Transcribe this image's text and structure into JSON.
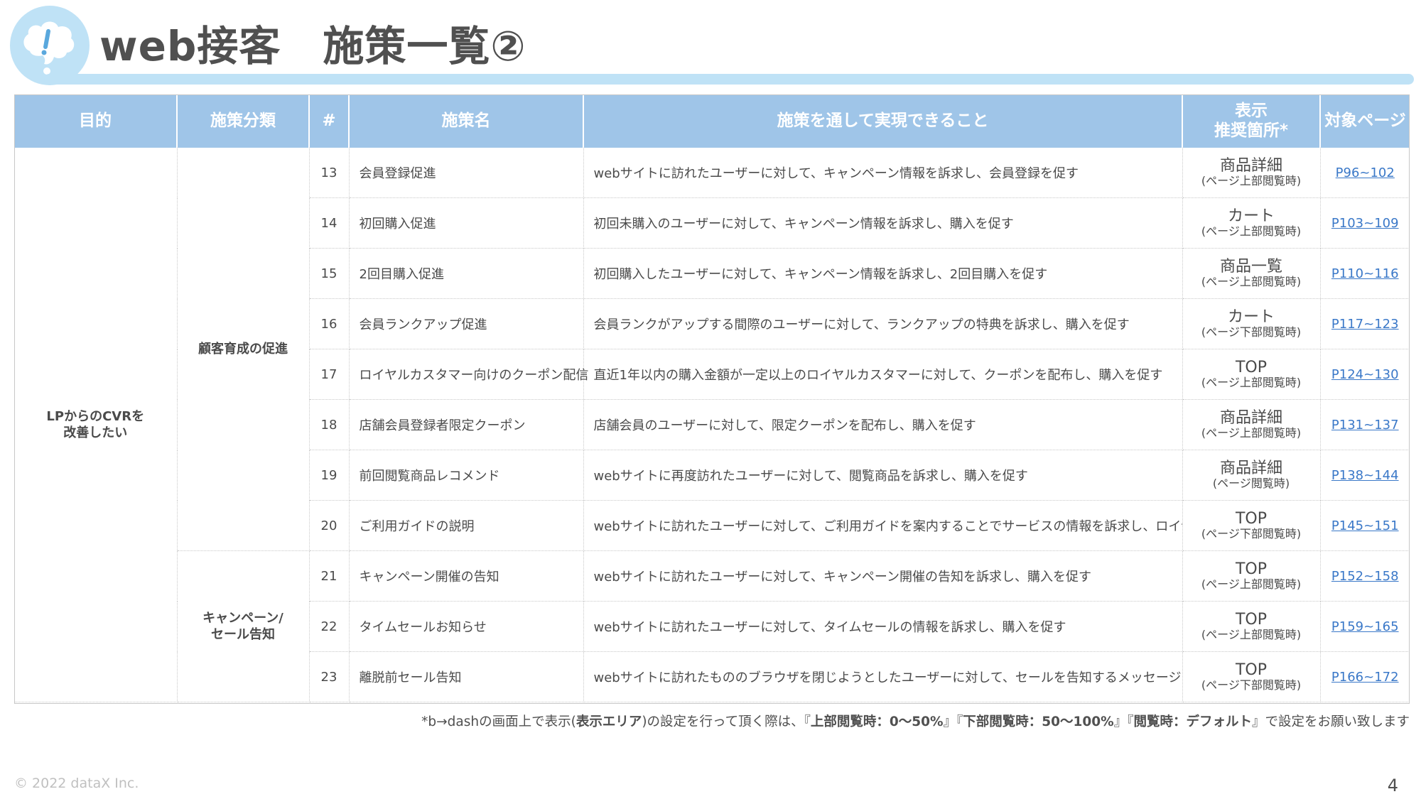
{
  "header": {
    "title": "web接客　施策一覧②",
    "logo_icon": "speech-bubble-exclamation-icon",
    "accent_color": "#bfe2f6"
  },
  "table": {
    "columns": [
      "目的",
      "施策分類",
      "#",
      "施策名",
      "施策を通して実現できること",
      "表示\n推奨箇所*",
      "対象ページ"
    ],
    "header_color": "#9fc5e8",
    "purpose": "LPからのCVRを\n改善したい",
    "categories": [
      {
        "label": "顧客育成の促進",
        "rows": 8
      },
      {
        "label": "キャンペーン/\nセール告知",
        "rows": 3
      }
    ],
    "rows": [
      {
        "num": "13",
        "name": "会員登録促進",
        "desc": "webサイトに訪れたユーザーに対して、キャンペーン情報を訴求し、会員登録を促す",
        "loc": "商品詳細",
        "loc_sub": "(ページ上部閲覧時)",
        "pages": "P96~102"
      },
      {
        "num": "14",
        "name": "初回購入促進",
        "desc": "初回未購入のユーザーに対して、キャンペーン情報を訴求し、購入を促す",
        "loc": "カート",
        "loc_sub": "(ページ上部閲覧時)",
        "pages": "P103~109"
      },
      {
        "num": "15",
        "name": "2回目購入促進",
        "desc": "初回購入したユーザーに対して、キャンペーン情報を訴求し、2回目購入を促す",
        "loc": "商品一覧",
        "loc_sub": "(ページ上部閲覧時)",
        "pages": "P110~116"
      },
      {
        "num": "16",
        "name": "会員ランクアップ促進",
        "desc": "会員ランクがアップする間際のユーザーに対して、ランクアップの特典を訴求し、購入を促す",
        "loc": "カート",
        "loc_sub": "(ページ下部閲覧時)",
        "pages": "P117~123"
      },
      {
        "num": "17",
        "name": "ロイヤルカスタマー向けのクーポン配信",
        "desc": "直近1年以内の購入金額が一定以上のロイヤルカスタマーに対して、クーポンを配布し、購入を促す",
        "loc": "TOP",
        "loc_sub": "(ページ上部閲覧時)",
        "pages": "P124~130"
      },
      {
        "num": "18",
        "name": "店舗会員登録者限定クーポン",
        "desc": "店舗会員のユーザーに対して、限定クーポンを配布し、購入を促す",
        "loc": "商品詳細",
        "loc_sub": "(ページ上部閲覧時)",
        "pages": "P131~137"
      },
      {
        "num": "19",
        "name": "前回閲覧商品レコメンド",
        "desc": "webサイトに再度訪れたユーザーに対して、閲覧商品を訴求し、購入を促す",
        "loc": "商品詳細",
        "loc_sub": "(ページ閲覧時)",
        "pages": "P138~144"
      },
      {
        "num": "20",
        "name": "ご利用ガイドの説明",
        "desc": "webサイトに訪れたユーザーに対して、ご利用ガイドを案内することでサービスの情報を訴求し、ロイヤリティの向上を促す",
        "loc": "TOP",
        "loc_sub": "(ページ下部閲覧時)",
        "pages": "P145~151"
      },
      {
        "num": "21",
        "name": "キャンペーン開催の告知",
        "desc": "webサイトに訪れたユーザーに対して、キャンペーン開催の告知を訴求し、購入を促す",
        "loc": "TOP",
        "loc_sub": "(ページ上部閲覧時)",
        "pages": "P152~158"
      },
      {
        "num": "22",
        "name": "タイムセールお知らせ",
        "desc": "webサイトに訪れたユーザーに対して、タイムセールの情報を訴求し、購入を促す",
        "loc": "TOP",
        "loc_sub": "(ページ上部閲覧時)",
        "pages": "P159~165"
      },
      {
        "num": "23",
        "name": "離脱前セール告知",
        "desc": "webサイトに訪れたもののブラウザを閉じようとしたユーザーに対して、セールを告知するメッセージを訴求し、離脱防止を促す",
        "loc": "TOP",
        "loc_sub": "(ページ下部閲覧時)",
        "pages": "P166~172"
      }
    ]
  },
  "footnote": {
    "prefix": "*b→dashの画面上で表示(",
    "area": "表示エリア",
    "mid": ")の設定を行って頂く際は、『",
    "upper": "上部閲覧時：0〜50%",
    "sep1": "』『",
    "lower": "下部閲覧時：50〜100%",
    "sep2": "』『",
    "default": "閲覧時：デフォルト",
    "suffix": "』で設定をお願い致します"
  },
  "footer": {
    "copyright": "© 2022 dataX Inc.",
    "page_number": "4"
  },
  "link_color": "#3a78c8"
}
